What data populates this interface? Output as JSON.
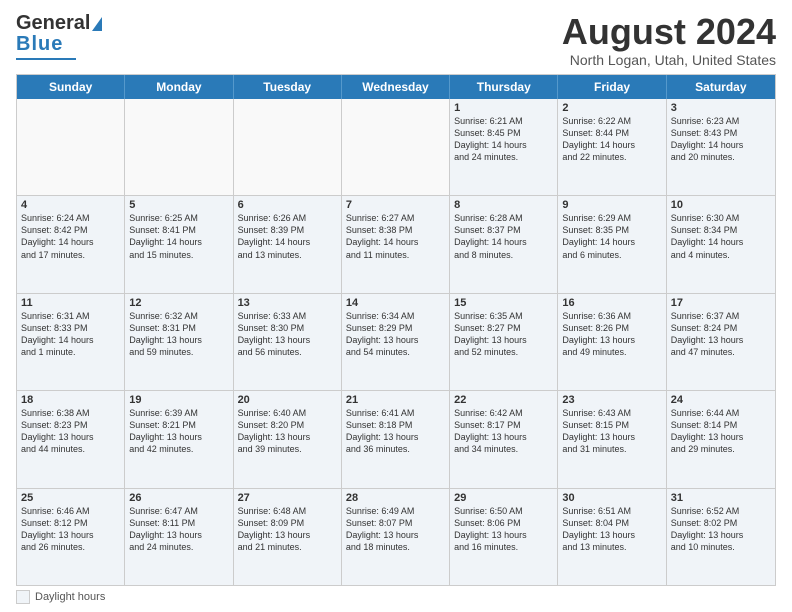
{
  "logo": {
    "line1": "General",
    "line2": "Blue"
  },
  "title": "August 2024",
  "subtitle": "North Logan, Utah, United States",
  "weekdays": [
    "Sunday",
    "Monday",
    "Tuesday",
    "Wednesday",
    "Thursday",
    "Friday",
    "Saturday"
  ],
  "footer": {
    "daylight_label": "Daylight hours"
  },
  "weeks": [
    [
      {
        "day": "",
        "info": ""
      },
      {
        "day": "",
        "info": ""
      },
      {
        "day": "",
        "info": ""
      },
      {
        "day": "",
        "info": ""
      },
      {
        "day": "1",
        "info": "Sunrise: 6:21 AM\nSunset: 8:45 PM\nDaylight: 14 hours\nand 24 minutes."
      },
      {
        "day": "2",
        "info": "Sunrise: 6:22 AM\nSunset: 8:44 PM\nDaylight: 14 hours\nand 22 minutes."
      },
      {
        "day": "3",
        "info": "Sunrise: 6:23 AM\nSunset: 8:43 PM\nDaylight: 14 hours\nand 20 minutes."
      }
    ],
    [
      {
        "day": "4",
        "info": "Sunrise: 6:24 AM\nSunset: 8:42 PM\nDaylight: 14 hours\nand 17 minutes."
      },
      {
        "day": "5",
        "info": "Sunrise: 6:25 AM\nSunset: 8:41 PM\nDaylight: 14 hours\nand 15 minutes."
      },
      {
        "day": "6",
        "info": "Sunrise: 6:26 AM\nSunset: 8:39 PM\nDaylight: 14 hours\nand 13 minutes."
      },
      {
        "day": "7",
        "info": "Sunrise: 6:27 AM\nSunset: 8:38 PM\nDaylight: 14 hours\nand 11 minutes."
      },
      {
        "day": "8",
        "info": "Sunrise: 6:28 AM\nSunset: 8:37 PM\nDaylight: 14 hours\nand 8 minutes."
      },
      {
        "day": "9",
        "info": "Sunrise: 6:29 AM\nSunset: 8:35 PM\nDaylight: 14 hours\nand 6 minutes."
      },
      {
        "day": "10",
        "info": "Sunrise: 6:30 AM\nSunset: 8:34 PM\nDaylight: 14 hours\nand 4 minutes."
      }
    ],
    [
      {
        "day": "11",
        "info": "Sunrise: 6:31 AM\nSunset: 8:33 PM\nDaylight: 14 hours\nand 1 minute."
      },
      {
        "day": "12",
        "info": "Sunrise: 6:32 AM\nSunset: 8:31 PM\nDaylight: 13 hours\nand 59 minutes."
      },
      {
        "day": "13",
        "info": "Sunrise: 6:33 AM\nSunset: 8:30 PM\nDaylight: 13 hours\nand 56 minutes."
      },
      {
        "day": "14",
        "info": "Sunrise: 6:34 AM\nSunset: 8:29 PM\nDaylight: 13 hours\nand 54 minutes."
      },
      {
        "day": "15",
        "info": "Sunrise: 6:35 AM\nSunset: 8:27 PM\nDaylight: 13 hours\nand 52 minutes."
      },
      {
        "day": "16",
        "info": "Sunrise: 6:36 AM\nSunset: 8:26 PM\nDaylight: 13 hours\nand 49 minutes."
      },
      {
        "day": "17",
        "info": "Sunrise: 6:37 AM\nSunset: 8:24 PM\nDaylight: 13 hours\nand 47 minutes."
      }
    ],
    [
      {
        "day": "18",
        "info": "Sunrise: 6:38 AM\nSunset: 8:23 PM\nDaylight: 13 hours\nand 44 minutes."
      },
      {
        "day": "19",
        "info": "Sunrise: 6:39 AM\nSunset: 8:21 PM\nDaylight: 13 hours\nand 42 minutes."
      },
      {
        "day": "20",
        "info": "Sunrise: 6:40 AM\nSunset: 8:20 PM\nDaylight: 13 hours\nand 39 minutes."
      },
      {
        "day": "21",
        "info": "Sunrise: 6:41 AM\nSunset: 8:18 PM\nDaylight: 13 hours\nand 36 minutes."
      },
      {
        "day": "22",
        "info": "Sunrise: 6:42 AM\nSunset: 8:17 PM\nDaylight: 13 hours\nand 34 minutes."
      },
      {
        "day": "23",
        "info": "Sunrise: 6:43 AM\nSunset: 8:15 PM\nDaylight: 13 hours\nand 31 minutes."
      },
      {
        "day": "24",
        "info": "Sunrise: 6:44 AM\nSunset: 8:14 PM\nDaylight: 13 hours\nand 29 minutes."
      }
    ],
    [
      {
        "day": "25",
        "info": "Sunrise: 6:46 AM\nSunset: 8:12 PM\nDaylight: 13 hours\nand 26 minutes."
      },
      {
        "day": "26",
        "info": "Sunrise: 6:47 AM\nSunset: 8:11 PM\nDaylight: 13 hours\nand 24 minutes."
      },
      {
        "day": "27",
        "info": "Sunrise: 6:48 AM\nSunset: 8:09 PM\nDaylight: 13 hours\nand 21 minutes."
      },
      {
        "day": "28",
        "info": "Sunrise: 6:49 AM\nSunset: 8:07 PM\nDaylight: 13 hours\nand 18 minutes."
      },
      {
        "day": "29",
        "info": "Sunrise: 6:50 AM\nSunset: 8:06 PM\nDaylight: 13 hours\nand 16 minutes."
      },
      {
        "day": "30",
        "info": "Sunrise: 6:51 AM\nSunset: 8:04 PM\nDaylight: 13 hours\nand 13 minutes."
      },
      {
        "day": "31",
        "info": "Sunrise: 6:52 AM\nSunset: 8:02 PM\nDaylight: 13 hours\nand 10 minutes."
      }
    ]
  ]
}
